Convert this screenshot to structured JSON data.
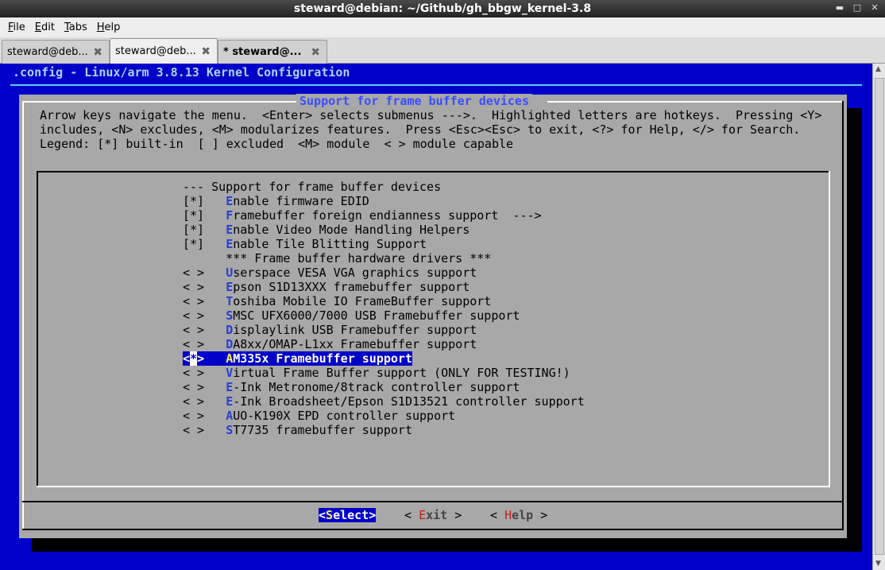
{
  "window": {
    "title": "steward@debian: ~/Github/gh_bbgw_kernel-3.8"
  },
  "menubar": {
    "items": [
      "File",
      "Edit",
      "Tabs",
      "Help"
    ]
  },
  "tabs": [
    {
      "label": "steward@deb...",
      "close": "✖"
    },
    {
      "label": "steward@deb...",
      "close": "✖"
    },
    {
      "label": "* steward@...",
      "close": "✖"
    }
  ],
  "terminal": {
    "config_title": ".config - Linux/arm 3.8.13 Kernel Configuration",
    "dialog_heading": "Support for frame buffer devices",
    "help_lines": [
      "Arrow keys navigate the menu.  <Enter> selects submenus --->.  Highlighted letters are hotkeys.  Pressing <Y>",
      "includes, <N> excludes, <M> modularizes features.  Press <Esc><Esc> to exit, <?> for Help, </> for Search.",
      "Legend: [*] built-in  [ ] excluded  <M> module  < > module capable"
    ],
    "entries": [
      {
        "prefix": "--- ",
        "hot": "",
        "text": "Support for frame buffer devices"
      },
      {
        "prefix": "[*]   ",
        "hot": "E",
        "text": "nable firmware EDID"
      },
      {
        "prefix": "[*]   ",
        "hot": "F",
        "text": "ramebuffer foreign endianness support  --->"
      },
      {
        "prefix": "[*]   ",
        "hot": "E",
        "text": "nable Video Mode Handling Helpers"
      },
      {
        "prefix": "[*]   ",
        "hot": "E",
        "text": "nable Tile Blitting Support"
      },
      {
        "prefix": "      ",
        "hot": "",
        "text": "*** Frame buffer hardware drivers ***"
      },
      {
        "prefix": "< >   ",
        "hot": "U",
        "text": "serspace VESA VGA graphics support"
      },
      {
        "prefix": "< >   ",
        "hot": "E",
        "text": "pson S1D13XXX framebuffer support"
      },
      {
        "prefix": "< >   ",
        "hot": "T",
        "text": "oshiba Mobile IO FrameBuffer support"
      },
      {
        "prefix": "< >   ",
        "hot": "S",
        "text": "MSC UFX6000/7000 USB Framebuffer support"
      },
      {
        "prefix": "< >   ",
        "hot": "D",
        "text": "isplaylink USB Framebuffer support"
      },
      {
        "prefix": "< >   ",
        "hot": "D",
        "text": "A8xx/OMAP-L1xx Framebuffer support"
      },
      {
        "prefix": "",
        "hot": "",
        "text": ""
      },
      {
        "prefix": "< >   ",
        "hot": "V",
        "text": "irtual Frame Buffer support (ONLY FOR TESTING!)"
      },
      {
        "prefix": "< >   ",
        "hot": "E",
        "text": "-Ink Metronome/8track controller support"
      },
      {
        "prefix": "< >   ",
        "hot": "E",
        "text": "-Ink Broadsheet/Epson S1D13521 controller support"
      },
      {
        "prefix": "< >   ",
        "hot": "A",
        "text": "UO-K190X EPD controller support"
      },
      {
        "prefix": "< >   ",
        "hot": "S",
        "text": "T7735 framebuffer support"
      }
    ],
    "selected": {
      "open": "<",
      "mark": "*",
      "close": ">   ",
      "hot": "A",
      "text": "M335x Framebuffer support"
    },
    "buttons": {
      "select": {
        "open": "<",
        "hot": "S",
        "rest": "elect",
        "close": ">"
      },
      "exit": {
        "open": "< ",
        "hot": "E",
        "rest": "xit",
        "close": " >"
      },
      "help": {
        "open": "< ",
        "hot": "H",
        "rest": "elp",
        "close": " >"
      }
    }
  },
  "colors": {
    "terminal_bg": "#0000c8",
    "dialog_bg": "#a8a8a8",
    "hotkey": "#2b3bd4",
    "selected_hotkey": "#ffef60"
  }
}
